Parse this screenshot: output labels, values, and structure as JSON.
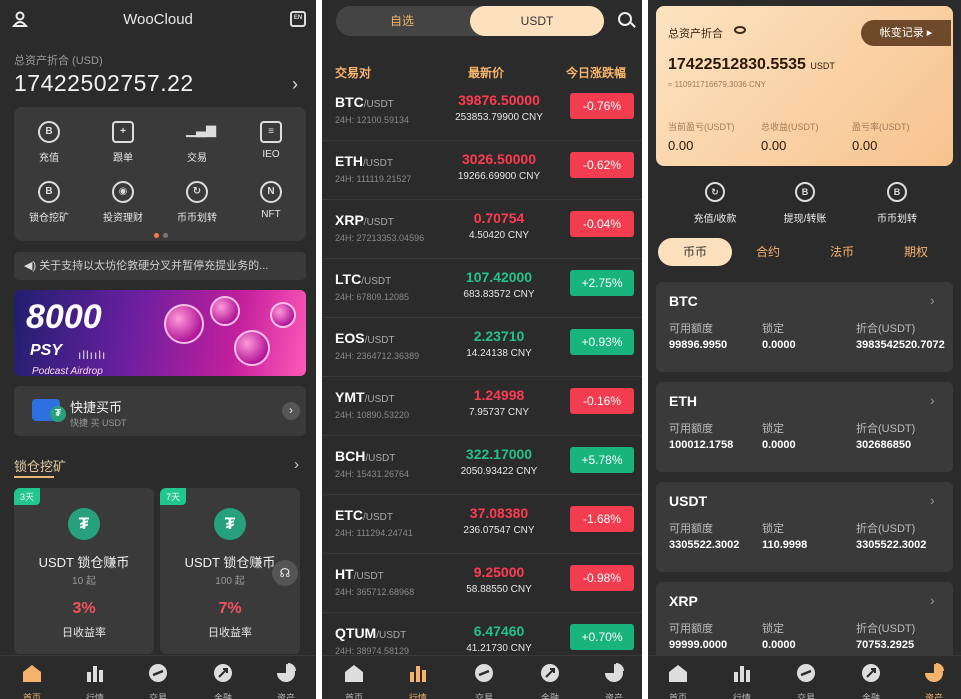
{
  "home": {
    "title": "WooCloud",
    "lang_badge": "EN",
    "asset_label": "总资产折合 (USD)",
    "asset_value": "17422502757.22",
    "quick": [
      {
        "label": "充值",
        "icon": "deposit-icon"
      },
      {
        "label": "跟单",
        "icon": "copy-trade-icon"
      },
      {
        "label": "交易",
        "icon": "trade-chart-icon"
      },
      {
        "label": "IEO",
        "icon": "ieo-icon"
      },
      {
        "label": "锁仓挖矿",
        "icon": "lock-mining-icon"
      },
      {
        "label": "投资理财",
        "icon": "invest-icon"
      },
      {
        "label": "币币划转",
        "icon": "transfer-icon"
      },
      {
        "label": "NFT",
        "icon": "nft-icon"
      }
    ],
    "notice": "关于支持以太坊伦敦硬分叉并暂停充提业务的...",
    "banner": {
      "amount": "8000",
      "token": "PSY",
      "caption": "Podcast Airdrop"
    },
    "buy": {
      "title": "快捷买币",
      "subtitle": "快捷 买 USDT"
    },
    "section_title": "锁仓挖矿",
    "staking": [
      {
        "days": "3天",
        "name": "USDT 锁仓赚币",
        "min": "10 起",
        "rate": "3%",
        "rate_label": "日收益率"
      },
      {
        "days": "7天",
        "name": "USDT 锁仓赚币",
        "min": "100 起",
        "rate": "7%",
        "rate_label": "日收益率"
      }
    ]
  },
  "tabs": [
    "首页",
    "行情",
    "交易",
    "金融",
    "资产"
  ],
  "market": {
    "seg_left": "自选",
    "seg_right": "USDT",
    "col_pair": "交易对",
    "col_price": "最新价",
    "col_change": "今日涨跌幅",
    "rows": [
      {
        "base": "BTC",
        "quote": "/USDT",
        "vol": "24H: 12100.59134",
        "price": "39876.50000",
        "cny": "253853.79900 CNY",
        "change": "-0.76%",
        "dir": "down"
      },
      {
        "base": "ETH",
        "quote": "/USDT",
        "vol": "24H: 111119.21527",
        "price": "3026.50000",
        "cny": "19266.69900 CNY",
        "change": "-0.62%",
        "dir": "down"
      },
      {
        "base": "XRP",
        "quote": "/USDT",
        "vol": "24H: 27213353.04596",
        "price": "0.70754",
        "cny": "4.50420 CNY",
        "change": "-0.04%",
        "dir": "down"
      },
      {
        "base": "LTC",
        "quote": "/USDT",
        "vol": "24H: 67809.12085",
        "price": "107.42000",
        "cny": "683.83572 CNY",
        "change": "+2.75%",
        "dir": "up"
      },
      {
        "base": "EOS",
        "quote": "/USDT",
        "vol": "24H: 2364712.36389",
        "price": "2.23710",
        "cny": "14.24138 CNY",
        "change": "+0.93%",
        "dir": "up"
      },
      {
        "base": "YMT",
        "quote": "/USDT",
        "vol": "24H: 10890.53220",
        "price": "1.24998",
        "cny": "7.95737 CNY",
        "change": "-0.16%",
        "dir": "down"
      },
      {
        "base": "BCH",
        "quote": "/USDT",
        "vol": "24H: 15431.26764",
        "price": "322.17000",
        "cny": "2050.93422 CNY",
        "change": "+5.78%",
        "dir": "up"
      },
      {
        "base": "ETC",
        "quote": "/USDT",
        "vol": "24H: 111294.24741",
        "price": "37.08380",
        "cny": "236.07547 CNY",
        "change": "-1.68%",
        "dir": "down"
      },
      {
        "base": "HT",
        "quote": "/USDT",
        "vol": "24H: 365712.68968",
        "price": "9.25000",
        "cny": "58.88550 CNY",
        "change": "-0.98%",
        "dir": "down"
      },
      {
        "base": "QTUM",
        "quote": "/USDT",
        "vol": "24H: 38974.58129",
        "price": "6.47460",
        "cny": "41.21730 CNY",
        "change": "+0.70%",
        "dir": "up"
      }
    ]
  },
  "assets": {
    "label": "总资产折合",
    "records": "帐变记录 ▸",
    "total": "17422512830.5535",
    "total_unit": "USDT",
    "total_cny": "≈ 110911716679.3036 CNY",
    "stats": [
      {
        "key": "当前盈亏(USDT)",
        "val": "0.00"
      },
      {
        "key": "总收益(USDT)",
        "val": "0.00"
      },
      {
        "key": "盈亏率(USDT)",
        "val": "0.00"
      }
    ],
    "actions": [
      {
        "label": "充值/收款",
        "icon": "deposit-icon"
      },
      {
        "label": "提现/转账",
        "icon": "withdraw-icon"
      },
      {
        "label": "币币划转",
        "icon": "transfer-icon"
      }
    ],
    "types": [
      "币币",
      "合约",
      "法币",
      "期权"
    ],
    "col_avail": "可用额度",
    "col_lock": "锁定",
    "col_conv": "折合(USDT)",
    "accounts": [
      {
        "coin": "BTC",
        "avail": "99896.9950",
        "lock": "0.0000",
        "conv": "3983542520.7072"
      },
      {
        "coin": "ETH",
        "avail": "100012.1758",
        "lock": "0.0000",
        "conv": "302686850"
      },
      {
        "coin": "USDT",
        "avail": "3305522.3002",
        "lock": "110.9998",
        "conv": "3305522.3002"
      },
      {
        "coin": "XRP",
        "avail": "99999.0000",
        "lock": "0.0000",
        "conv": "70753.2925"
      }
    ]
  }
}
